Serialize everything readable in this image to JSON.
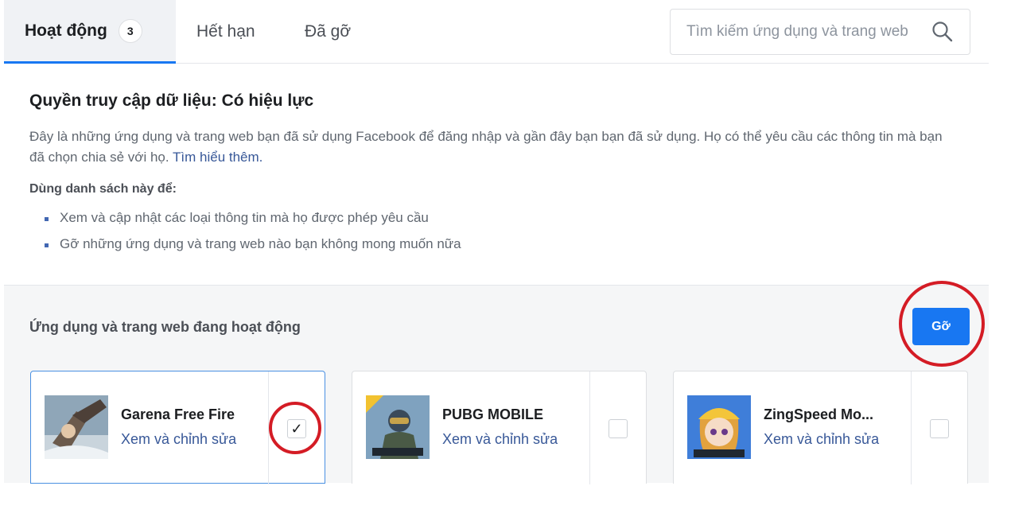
{
  "tabs": {
    "active_label": "Hoạt động",
    "active_count": "3",
    "expired_label": "Hết hạn",
    "removed_label": "Đã gỡ"
  },
  "search": {
    "placeholder": "Tìm kiếm ứng dụng và trang web",
    "icon": "search-icon"
  },
  "info": {
    "title": "Quyền truy cập dữ liệu: Có hiệu lực",
    "description": "Đây là những ứng dụng và trang web bạn đã sử dụng Facebook để đăng nhập và gần đây bạn bạn đã sử dụng. Họ có thể yêu cầu các thông tin mà bạn đã chọn chia sẻ với họ.",
    "learn_more": "Tìm hiểu thêm.",
    "use_title": "Dùng danh sách này để:",
    "bullets": [
      "Xem và cập nhật các loại thông tin mà họ được phép yêu cầu",
      "Gỡ những ứng dụng và trang web nào bạn không mong muốn nữa"
    ]
  },
  "apps": {
    "section_title": "Ứng dụng và trang web đang hoạt động",
    "remove_button": "Gỡ",
    "items": [
      {
        "name": "Garena Free Fire",
        "link": "Xem và chỉnh sửa",
        "checked": true,
        "check_mark": "✓"
      },
      {
        "name": "PUBG MOBILE",
        "link": "Xem và chỉnh sửa",
        "checked": false
      },
      {
        "name": "ZingSpeed Mo...",
        "link": "Xem và chỉnh sửa",
        "checked": false
      }
    ]
  },
  "colors": {
    "accent": "#1877f2",
    "link": "#385898",
    "annotation": "#d41c25"
  }
}
